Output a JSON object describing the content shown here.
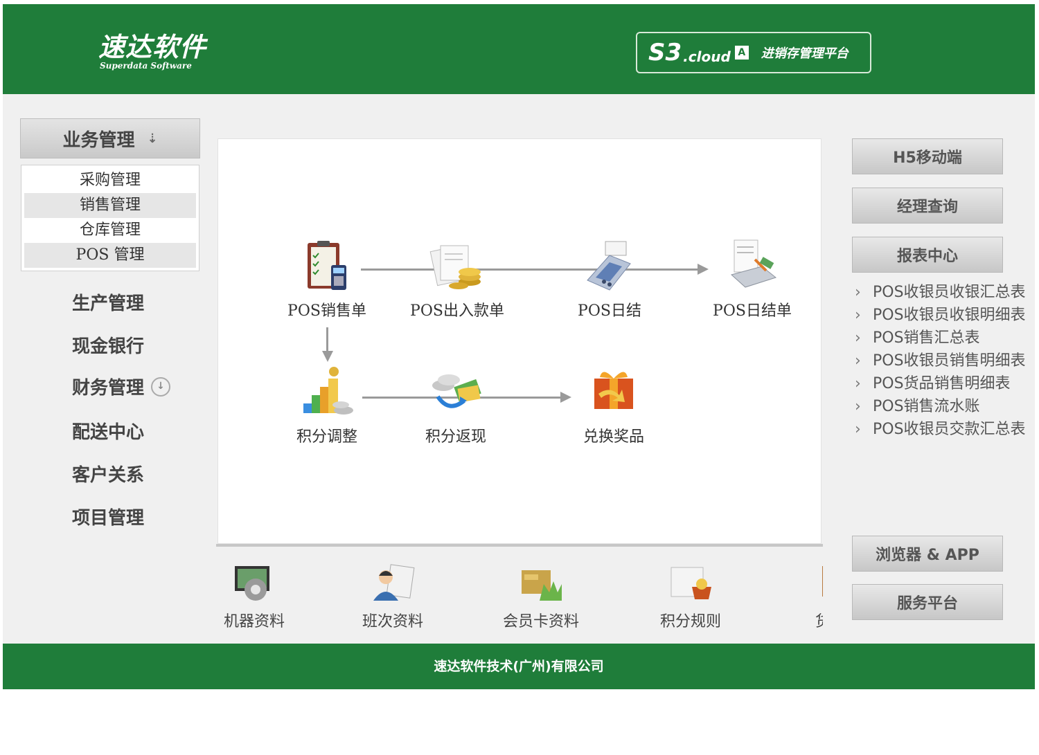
{
  "header": {
    "logo_cn": "速达软件",
    "logo_en": "Superdata Software",
    "brand_s3": "S3",
    "brand_cloud": ".cloud",
    "brand_badge": "A",
    "brand_subtitle": "进销存管理平台"
  },
  "sidebar": {
    "section_title": "业务管理",
    "submenu": [
      {
        "label": "采购管理"
      },
      {
        "label": "销售管理"
      },
      {
        "label": "仓库管理"
      },
      {
        "label": "POS 管理"
      }
    ],
    "items": [
      {
        "label": "生产管理"
      },
      {
        "label": "现金银行"
      },
      {
        "label": "财务管理"
      },
      {
        "label": "配送中心"
      },
      {
        "label": "客户关系"
      },
      {
        "label": "项目管理"
      }
    ]
  },
  "workflow": {
    "row1": [
      {
        "label": "POS销售单",
        "icon": "clipboard-pos-icon"
      },
      {
        "label": "POS出入款单",
        "icon": "documents-coins-icon"
      },
      {
        "label": "POS日结",
        "icon": "card-terminal-icon"
      },
      {
        "label": "POS日结单",
        "icon": "receipt-printer-icon"
      }
    ],
    "row2": [
      {
        "label": "积分调整",
        "icon": "points-stairs-icon"
      },
      {
        "label": "积分返现",
        "icon": "cashback-icon"
      },
      {
        "label": "兑换奖品",
        "icon": "gift-box-icon"
      }
    ]
  },
  "bottom_strip": [
    {
      "label": "机器资料",
      "icon": "machine-gear-icon"
    },
    {
      "label": "班次资料",
      "icon": "shift-person-icon"
    },
    {
      "label": "会员卡资料",
      "icon": "member-card-icon"
    },
    {
      "label": "积分规则",
      "icon": "points-rule-icon"
    },
    {
      "label": "货品",
      "icon": "goods-box-icon"
    }
  ],
  "right_panel": {
    "buttons_top": [
      {
        "label": "H5移动端"
      },
      {
        "label": "经理查询"
      },
      {
        "label": "报表中心"
      }
    ],
    "reports": [
      {
        "label": "POS收银员收银汇总表"
      },
      {
        "label": "POS收银员收银明细表"
      },
      {
        "label": "POS销售汇总表"
      },
      {
        "label": "POS收银员销售明细表"
      },
      {
        "label": "POS货品销售明细表"
      },
      {
        "label": "POS销售流水账"
      },
      {
        "label": "POS收银员交款汇总表"
      }
    ],
    "buttons_bottom": [
      {
        "label": "浏览器 & APP"
      },
      {
        "label": "服务平台"
      }
    ]
  },
  "footer": {
    "company": "速达软件技术(广州)有限公司"
  }
}
